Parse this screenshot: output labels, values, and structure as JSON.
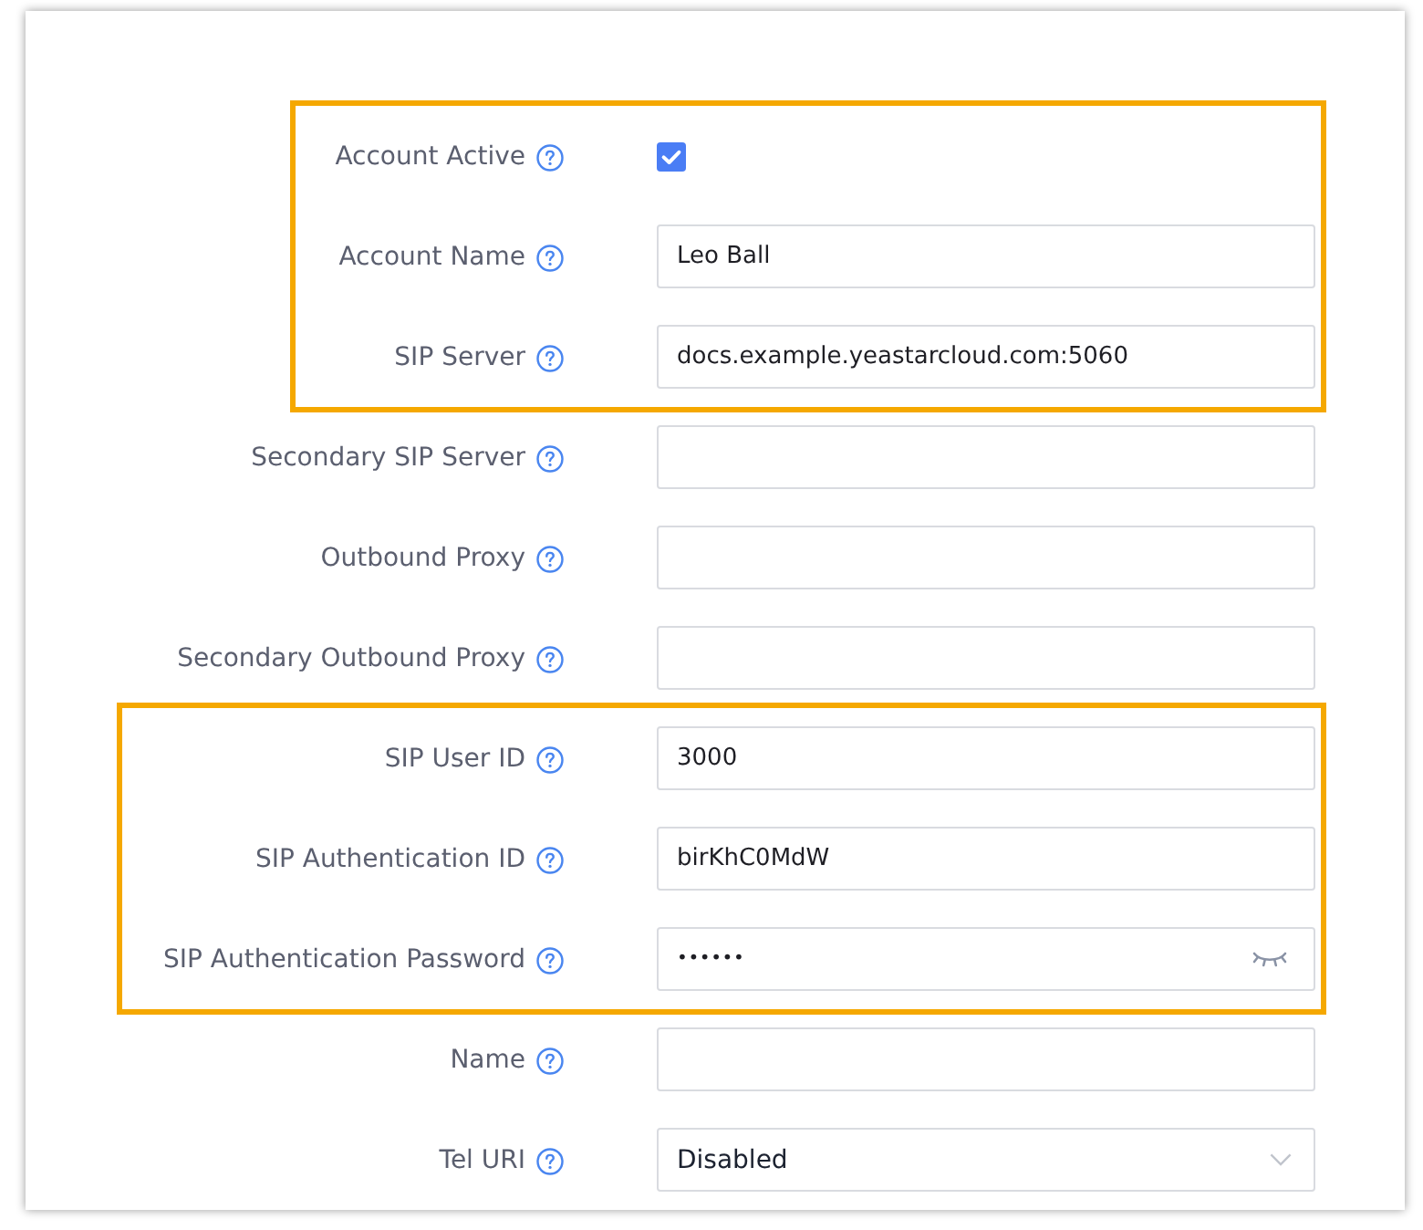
{
  "form": {
    "sections": [
      {
        "highlighted": true,
        "fields": [
          {
            "kind": "checkbox",
            "label": "Account Active",
            "checked": true
          },
          {
            "kind": "text",
            "label": "Account Name",
            "value": "Leo Ball"
          },
          {
            "kind": "text",
            "label": "SIP Server",
            "value": "docs.example.yeastarcloud.com:5060"
          }
        ]
      },
      {
        "highlighted": false,
        "fields": [
          {
            "kind": "text",
            "label": "Secondary SIP Server"
          },
          {
            "kind": "text",
            "label": "Outbound Proxy"
          },
          {
            "kind": "text",
            "label": "Secondary Outbound Proxy"
          }
        ]
      },
      {
        "highlighted": true,
        "fields": [
          {
            "kind": "text",
            "label": "SIP User ID",
            "value": "3000"
          },
          {
            "kind": "text",
            "label": "SIP Authentication ID",
            "value": "birKhC0MdW"
          },
          {
            "kind": "password",
            "label": "SIP Authentication Password",
            "value": "••••••"
          }
        ]
      },
      {
        "highlighted": false,
        "fields": [
          {
            "kind": "text",
            "label": "Name"
          },
          {
            "kind": "select",
            "label": "Tel URI",
            "value": "Disabled"
          }
        ]
      }
    ]
  }
}
